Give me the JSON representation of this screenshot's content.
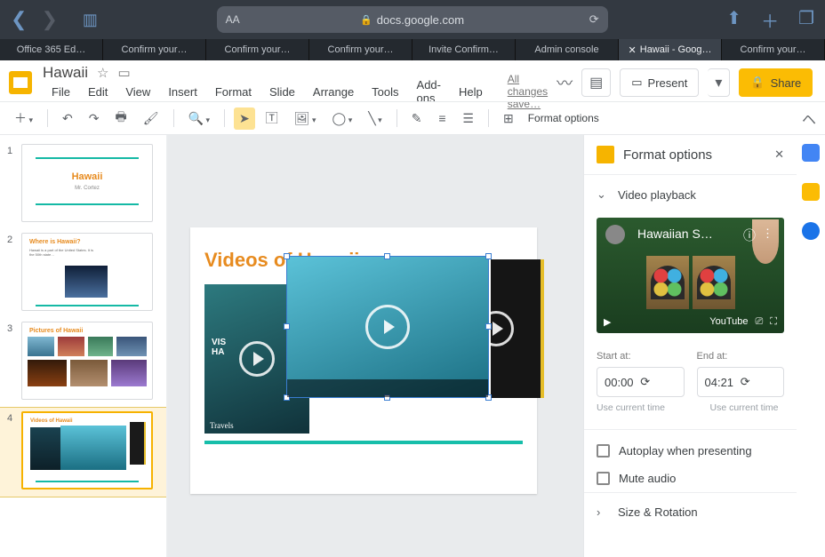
{
  "browser": {
    "url_display": "docs.google.com",
    "tabs": [
      {
        "label": "Office 365 Ed…",
        "active": false
      },
      {
        "label": "Confirm your…",
        "active": false
      },
      {
        "label": "Confirm your…",
        "active": false
      },
      {
        "label": "Confirm your…",
        "active": false
      },
      {
        "label": "Invite Confirm…",
        "active": false
      },
      {
        "label": "Admin console",
        "active": false
      },
      {
        "label": "Hawaii - Goog…",
        "active": true
      },
      {
        "label": "Confirm your…",
        "active": false
      }
    ]
  },
  "doc": {
    "title": "Hawaii",
    "menus": [
      "File",
      "Edit",
      "View",
      "Insert",
      "Format",
      "Slide",
      "Arrange",
      "Tools",
      "Add-ons",
      "Help"
    ],
    "save_status": "All changes save…",
    "present_label": "Present",
    "share_label": "Share",
    "format_options_btn": "Format options"
  },
  "thumbs": [
    {
      "num": "1",
      "title": "Hawaii",
      "subtitle": "Mr. Cortez"
    },
    {
      "num": "2",
      "title": "Where is Hawaii?"
    },
    {
      "num": "3",
      "title": "Pictures of Hawaii"
    },
    {
      "num": "4",
      "title": "Videos of Hawaii",
      "current": true
    }
  ],
  "canvas": {
    "title": "Videos of Hawaii",
    "travels_label": "Travels"
  },
  "side": {
    "panel_title": "Format options",
    "video_playback": "Video playback",
    "preview_title": "Hawaiian S…",
    "youtube_label": "YouTube",
    "start_label": "Start at:",
    "end_label": "End at:",
    "start_value": "00:00",
    "end_value": "04:21",
    "use_current": "Use current time",
    "autoplay": "Autoplay when presenting",
    "mute": "Mute audio",
    "size_rotation": "Size & Rotation"
  }
}
